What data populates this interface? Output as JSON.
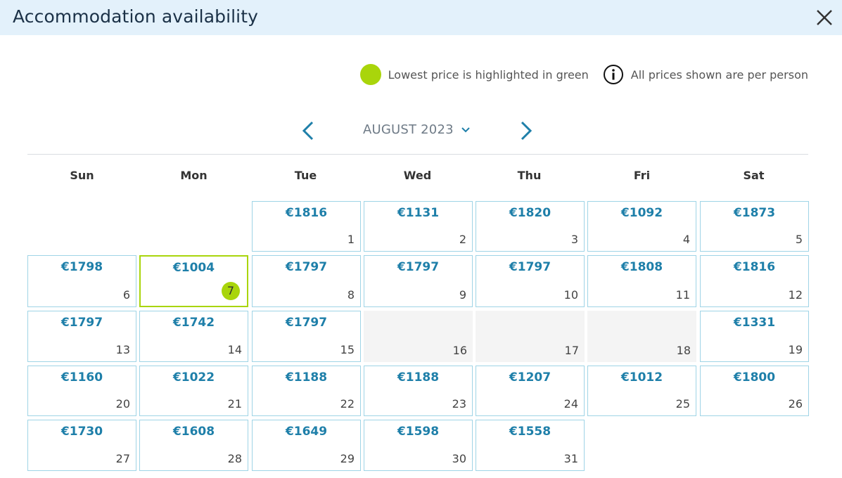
{
  "header": {
    "title": "Accommodation availability"
  },
  "legend": {
    "lowest_price": "Lowest price is highlighted in green",
    "per_person": "All prices shown are per person",
    "highlight_color": "#a9d50b"
  },
  "calendar": {
    "month_label": "AUGUST 2023",
    "weekdays": [
      "Sun",
      "Mon",
      "Tue",
      "Wed",
      "Thu",
      "Fri",
      "Sat"
    ],
    "days": [
      {
        "day": "1",
        "price": "€1816"
      },
      {
        "day": "2",
        "price": "€1131"
      },
      {
        "day": "3",
        "price": "€1820"
      },
      {
        "day": "4",
        "price": "€1092"
      },
      {
        "day": "5",
        "price": "€1873"
      },
      {
        "day": "6",
        "price": "€1798"
      },
      {
        "day": "7",
        "price": "€1004",
        "lowest": true
      },
      {
        "day": "8",
        "price": "€1797"
      },
      {
        "day": "9",
        "price": "€1797"
      },
      {
        "day": "10",
        "price": "€1797"
      },
      {
        "day": "11",
        "price": "€1808"
      },
      {
        "day": "12",
        "price": "€1816"
      },
      {
        "day": "13",
        "price": "€1797"
      },
      {
        "day": "14",
        "price": "€1742"
      },
      {
        "day": "15",
        "price": "€1797"
      },
      {
        "day": "16",
        "price": null
      },
      {
        "day": "17",
        "price": null
      },
      {
        "day": "18",
        "price": null
      },
      {
        "day": "19",
        "price": "€1331"
      },
      {
        "day": "20",
        "price": "€1160"
      },
      {
        "day": "21",
        "price": "€1022"
      },
      {
        "day": "22",
        "price": "€1188"
      },
      {
        "day": "23",
        "price": "€1188"
      },
      {
        "day": "24",
        "price": "€1207"
      },
      {
        "day": "25",
        "price": "€1012"
      },
      {
        "day": "26",
        "price": "€1800"
      },
      {
        "day": "27",
        "price": "€1730"
      },
      {
        "day": "28",
        "price": "€1608"
      },
      {
        "day": "29",
        "price": "€1649"
      },
      {
        "day": "30",
        "price": "€1598"
      },
      {
        "day": "31",
        "price": "€1558"
      }
    ]
  },
  "colors": {
    "header_bg": "#e3f1fb",
    "price": "#1e7fa9",
    "cell_border": "#9fd4e6",
    "nav_arrow": "#1e7fa9"
  }
}
